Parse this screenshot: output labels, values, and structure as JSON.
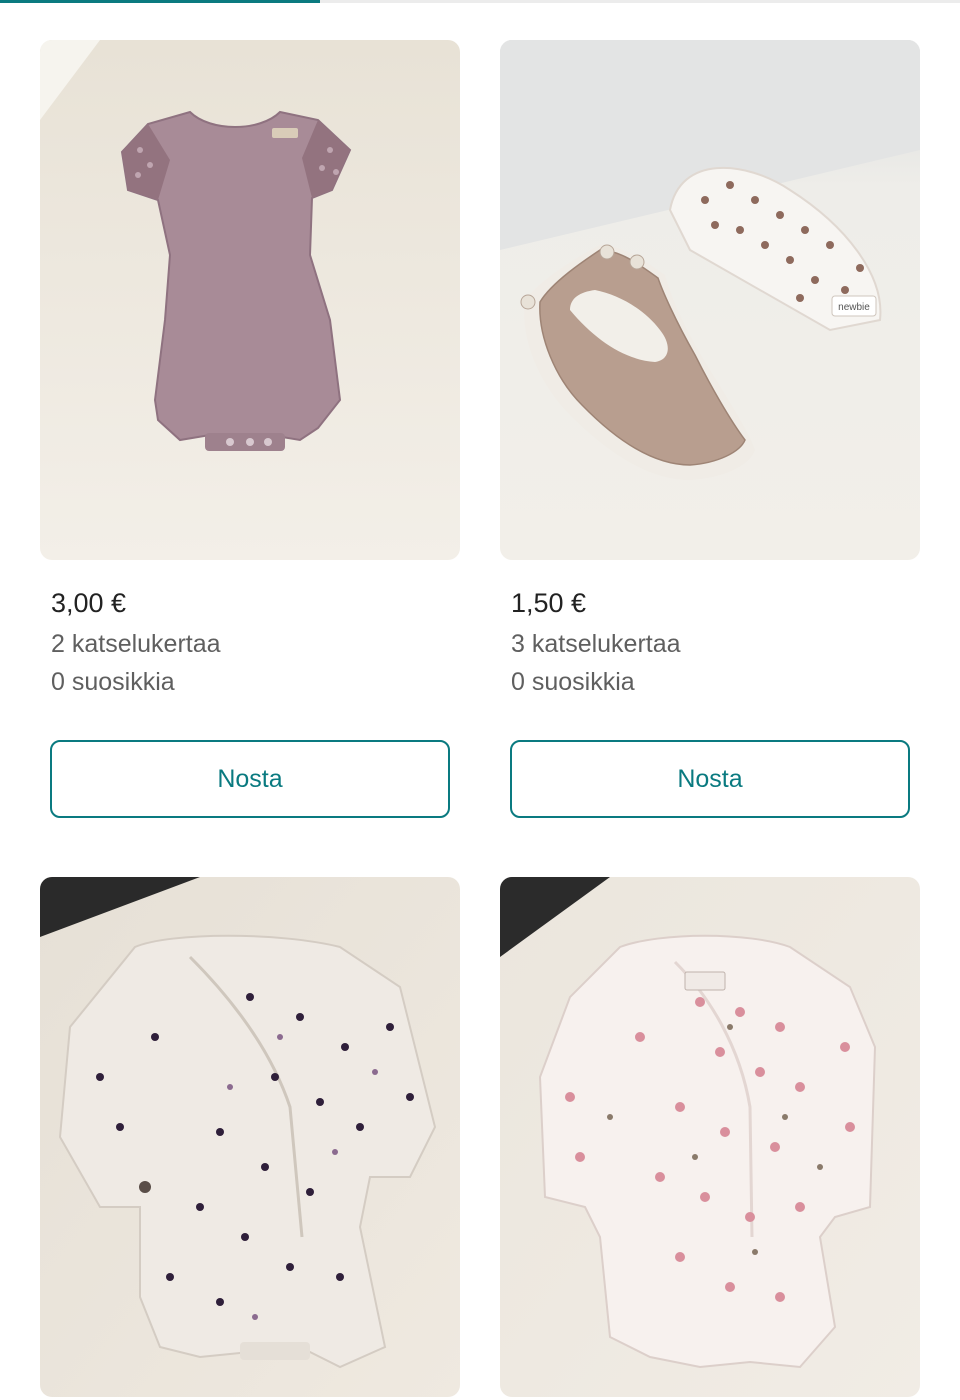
{
  "colors": {
    "accent": "#0a7a80",
    "text_primary": "#222222",
    "text_secondary": "#5f5f5f"
  },
  "listings": [
    {
      "image": "purple-short-sleeve-bodysuit",
      "brand_tag": "",
      "price": "3,00 €",
      "views": "2 katselukertaa",
      "favorites": "0 suosikkia",
      "action_label": "Nosta"
    },
    {
      "image": "bib-and-floral-hat",
      "brand_tag": "newbie",
      "price": "1,50 €",
      "views": "3 katselukertaa",
      "favorites": "0 suosikkia",
      "action_label": "Nosta"
    },
    {
      "image": "white-floral-wrap-bodysuit",
      "brand_tag": ""
    },
    {
      "image": "pink-floral-wrap-bodysuit",
      "brand_tag": ""
    }
  ]
}
